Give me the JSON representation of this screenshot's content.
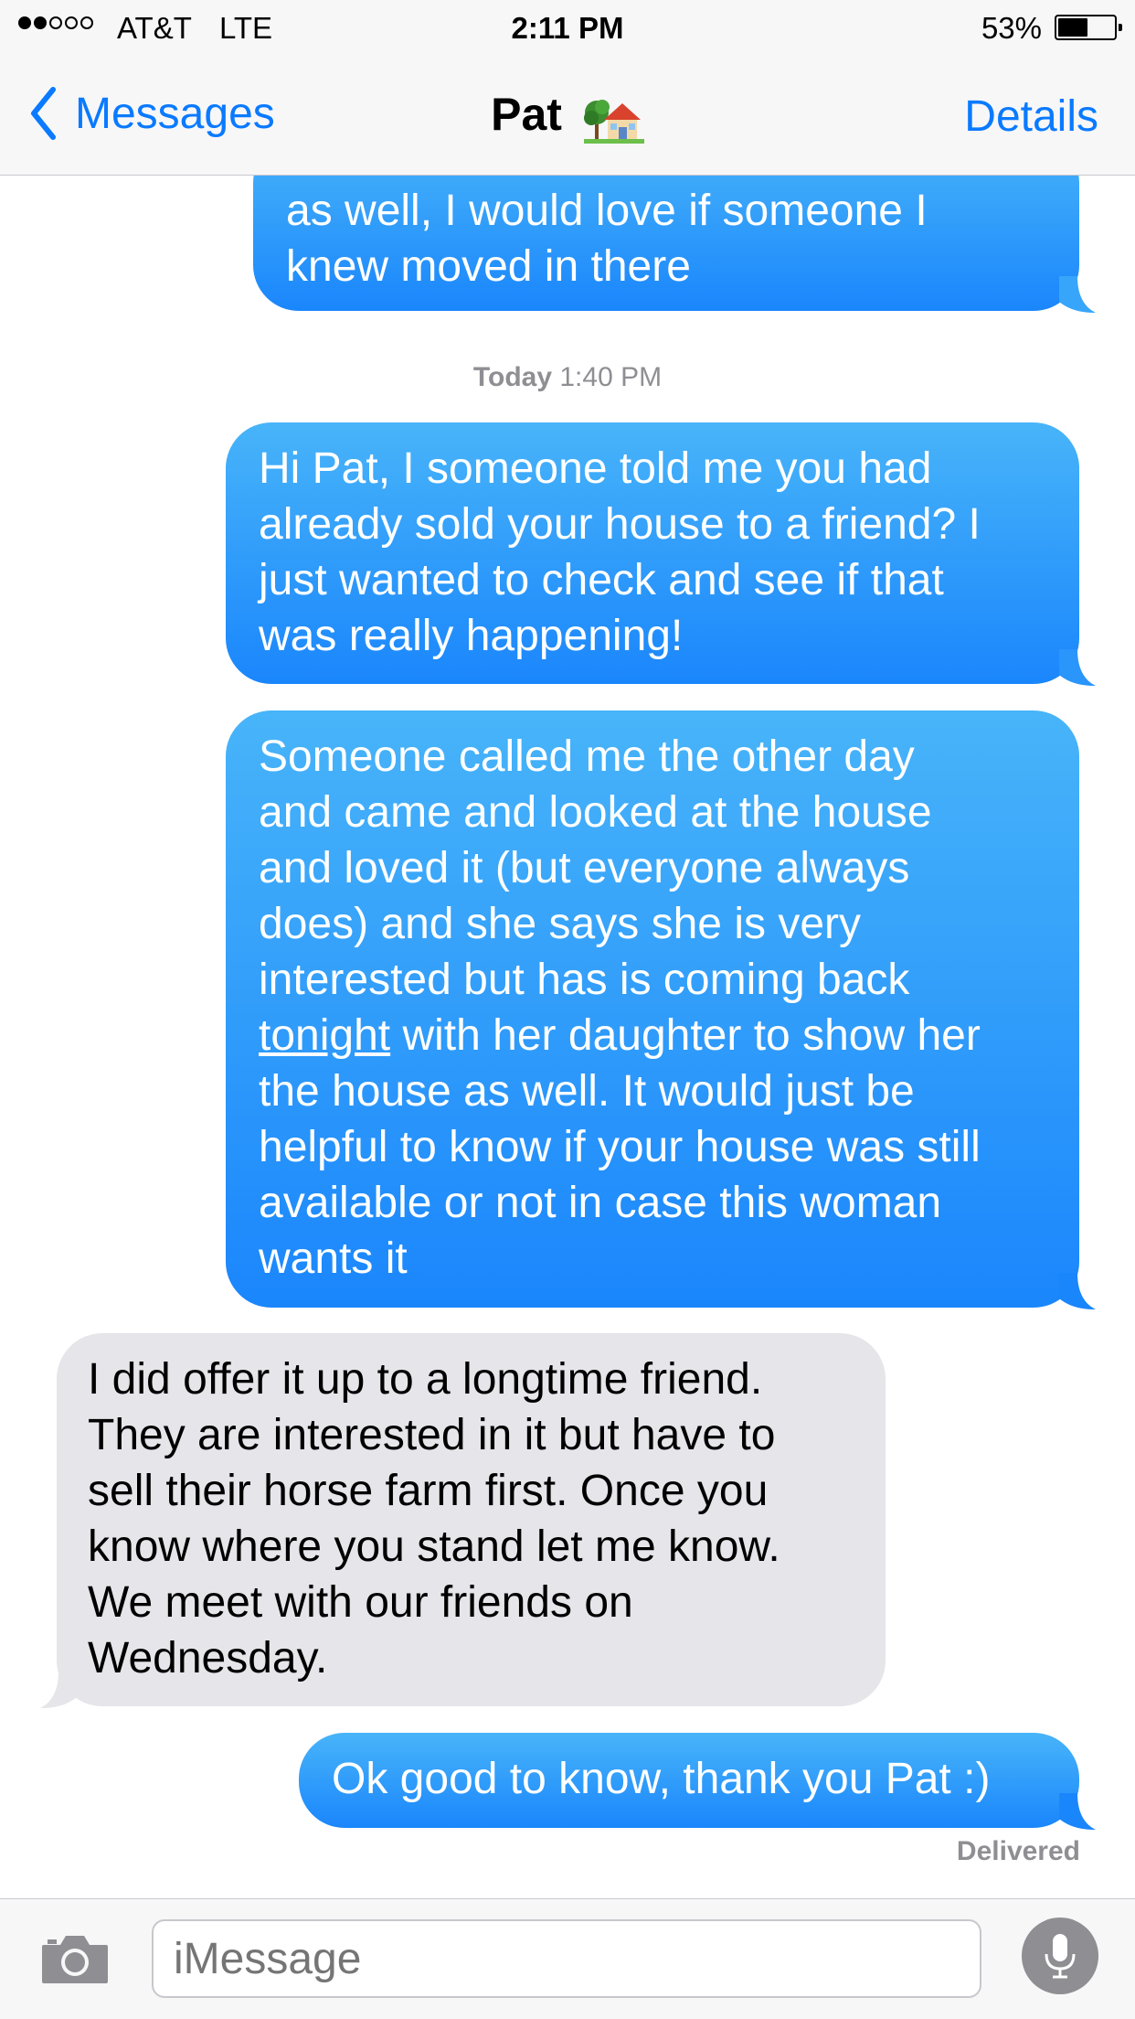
{
  "status_bar": {
    "signal_dots_filled": 2,
    "signal_dots_total": 5,
    "carrier": "AT&T",
    "network": "LTE",
    "time": "2:11 PM",
    "battery_percent": "53%",
    "battery_level": 0.53
  },
  "nav": {
    "back_label": "Messages",
    "title": "Pat",
    "title_icon": "house-with-garden-emoji",
    "details_label": "Details"
  },
  "conversation": {
    "messages": [
      {
        "direction": "outgoing",
        "text": "as well, I would love if someone I\nknew moved in there"
      },
      {
        "direction": "outgoing",
        "text": "Hi Pat, I someone told me you had\nalready sold your house to a friend? I\njust wanted to check and see if that\nwas really happening!"
      },
      {
        "direction": "outgoing",
        "text_before": "Someone called me the other day\nand came and looked at the house\nand loved it (but everyone always\ndoes) and she says she is very\ninterested but has is coming back\n",
        "text_link": "tonight",
        "text_after": " with her daughter to show her\nthe house as well. It would just be\nhelpful to know if your house was still\navailable or not in case this woman\nwants it"
      },
      {
        "direction": "incoming",
        "text": "I did offer it up to a longtime friend.\nThey are interested in it but have to\nsell their horse farm first. Once you\nknow where you stand let me know.\nWe meet with our friends on\nWednesday."
      },
      {
        "direction": "outgoing",
        "text": "Ok good to know, thank you Pat :)"
      }
    ],
    "timestamp_day": "Today",
    "timestamp_time": "1:40 PM",
    "delivered_label": "Delivered"
  },
  "input": {
    "placeholder": "iMessage"
  },
  "colors": {
    "accent": "#0a7aff",
    "outgoing_top": "#48b4f9",
    "outgoing_bottom": "#1a86fc",
    "incoming": "#e5e5ea",
    "meta_gray": "#8e8e93"
  }
}
